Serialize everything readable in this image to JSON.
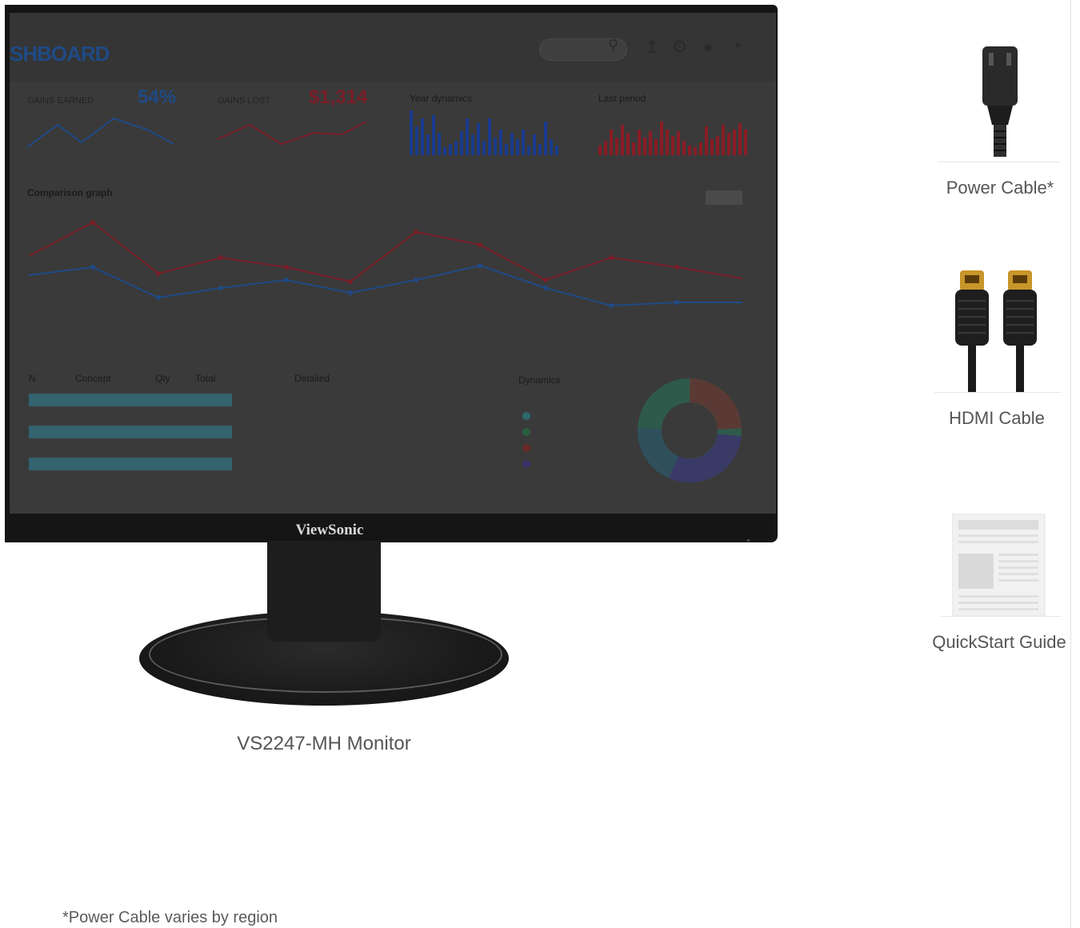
{
  "monitor": {
    "brand": "ViewSonic",
    "caption": "VS2247-MH Monitor",
    "screen": {
      "title": "SHBOARD",
      "stats": [
        {
          "label": "GAINS EARNED",
          "value": "54%",
          "color": "#1f4a86"
        },
        {
          "label": "GAINS LOST",
          "value": "$1,314",
          "color": "#7a1f28"
        }
      ],
      "year_dynamics": "Year dynamics",
      "last_period": "Last period",
      "comparison_graph": "Comparison graph",
      "table_headers": [
        "N",
        "Concept",
        "Qty",
        "Total"
      ],
      "detailed": "Detailed",
      "dynamics": "Dynamics"
    }
  },
  "accessories": [
    {
      "label": "Power Cable*",
      "icon": "power-cable-icon"
    },
    {
      "label": "HDMI Cable",
      "icon": "hdmi-cable-icon"
    },
    {
      "label": "QuickStart Guide",
      "icon": "quickstart-guide-icon"
    }
  ],
  "footnote": "*Power Cable varies by region",
  "colors": {
    "blue": "#1f4a86",
    "red": "#7a1f28",
    "bezel": "#151515"
  }
}
